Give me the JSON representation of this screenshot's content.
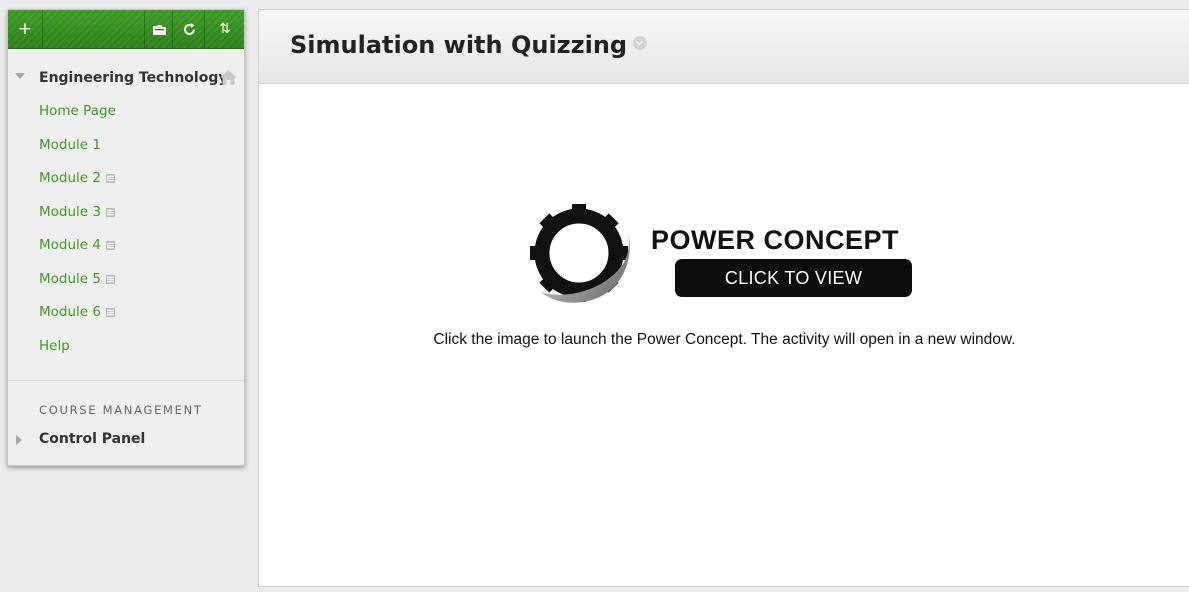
{
  "toolbar": {
    "add_icon": "plus-icon",
    "folder_icon": "folder-icon",
    "refresh_icon": "refresh-icon",
    "sort_icon": "sort-arrows-icon",
    "colors": {
      "toolbar_green": "#2c7f18"
    }
  },
  "course": {
    "title": "Engineering Technology",
    "home_icon": "home-icon"
  },
  "menu": {
    "items": [
      {
        "label": "Home Page",
        "hidden": false
      },
      {
        "label": "Module 1",
        "hidden": false
      },
      {
        "label": "Module 2",
        "hidden": true
      },
      {
        "label": "Module 3",
        "hidden": true
      },
      {
        "label": "Module 4",
        "hidden": true
      },
      {
        "label": "Module 5",
        "hidden": true
      },
      {
        "label": "Module 6",
        "hidden": true
      },
      {
        "label": "Help",
        "hidden": false
      }
    ],
    "link_color": "#3f9a23"
  },
  "course_management": {
    "heading": "COURSE MANAGEMENT",
    "control_panel": "Control Panel"
  },
  "content": {
    "title": "Simulation with Quizzing",
    "power_concept": {
      "title": "POWER CONCEPT",
      "cta": "CLICK TO VIEW",
      "icon": "gear-icon"
    },
    "description": "Click the image to launch the Power Concept. The activity will open in a new window."
  }
}
